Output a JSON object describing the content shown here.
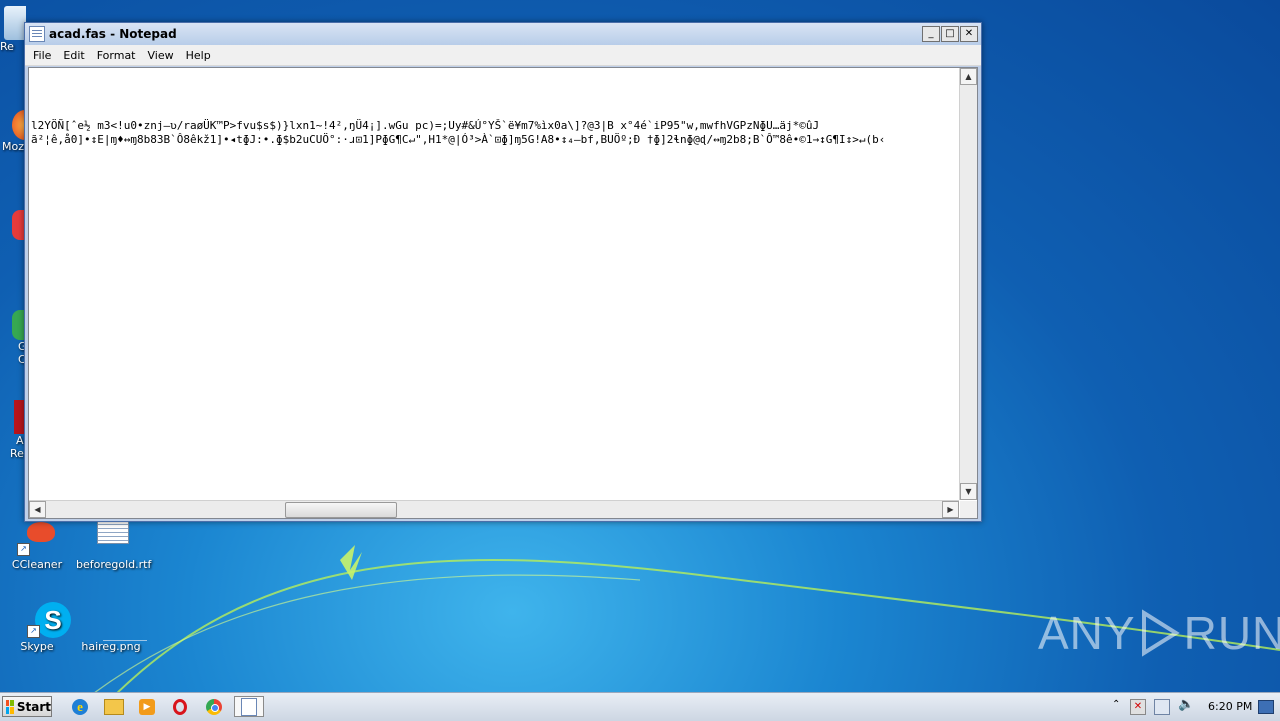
{
  "window": {
    "title": "acad.fas - Notepad",
    "controls": {
      "minimize": "_",
      "maximize": "□",
      "close": "✕"
    },
    "menu": [
      "File",
      "Edit",
      "Format",
      "View",
      "Help"
    ],
    "content_lines": [
      "l2YÖÑ[ˆe½ m3<!u0•znj–ʋ/raøÜK™P>fvu$s$)}lxn1~!4²,ŋÜ4¡].wGu pc)=;Uy#&Ú°YŠ`ë¥m7%ìx0a\\]?@3|B x°4é`iP95\"w,mwfhVGPzNɸU…äj*©ûJ",
      "ã²¦ê,å0]•↕E|ɱ♦↔ɱ8b83B`Ô8êkž1]•◂tɸJ:•.ɸ$b2uCUÖ°:·ɹ⊡1]PɸG¶C↵\",H1*@|Ó³>À`⊡ɸ]ɱ5G!A8•↕₄–bf,BUÖº;Ð †ɸ]2ɬnɸ@ɖ/↔ɱ2b8;B`Ô™8ê•©1→↕G¶I↕>↵(b‹"
    ]
  },
  "desktop": {
    "icons": [
      {
        "label": "CCleaner"
      },
      {
        "label": "beforegold.rtf"
      },
      {
        "label": "Skype"
      },
      {
        "label": "haireg.png"
      }
    ],
    "edge_labels": [
      "Re",
      "Moz",
      "G",
      "C",
      "A",
      "Re"
    ]
  },
  "watermark": {
    "left": "ANY",
    "right": "RUN"
  },
  "taskbar": {
    "start_label": "Start",
    "clock": "6:20 PM",
    "pinned": [
      "internet-explorer-icon",
      "explorer-icon",
      "media-player-icon",
      "opera-icon",
      "chrome-icon",
      "notepad-icon"
    ]
  },
  "colors": {
    "accent": "#1b86d1",
    "window_border": "#4a6ea9"
  }
}
